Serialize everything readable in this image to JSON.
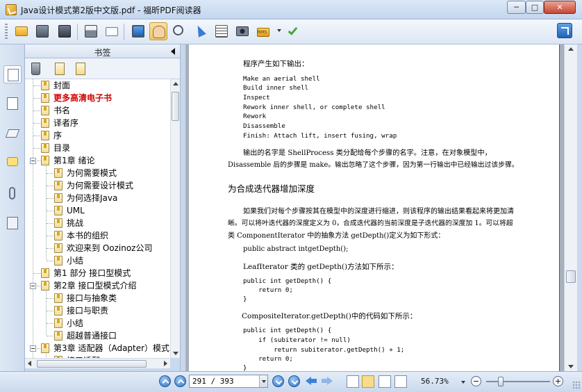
{
  "window": {
    "title": "Java设计模式第2版中文版.pdf - 福昕PDF阅读器",
    "minimize": "─",
    "maximize": "□",
    "close": "✕"
  },
  "toolbar": {
    "icons": [
      "open-folder-icon",
      "save-icon",
      "save-as-icon",
      "print-icon",
      "email-icon",
      "fullscreen-icon",
      "hand-tool-icon",
      "loupe-icon",
      "select-arrow-icon",
      "text-select-icon",
      "snapshot-icon",
      "rms-lock-icon",
      "sign-check-icon"
    ],
    "rms_label": "RMS"
  },
  "sidebar": {
    "title": "书签",
    "tabs": [
      "bookmarks-tab",
      "pages-tab",
      "layers-tab",
      "comments-tab",
      "attachments-tab",
      "signatures-tab"
    ],
    "tools": [
      "delete-bookmark-icon",
      "new-bookmark-icon",
      "new-child-bookmark-icon"
    ],
    "items": [
      {
        "label": "封面",
        "level": 0
      },
      {
        "label": "更多高清电子书",
        "level": 0,
        "highlight": true
      },
      {
        "label": "书名",
        "level": 0
      },
      {
        "label": "译者序",
        "level": 0
      },
      {
        "label": "序",
        "level": 0
      },
      {
        "label": "目录",
        "level": 0
      },
      {
        "label": "第1章 绪论",
        "level": 0,
        "expanded": true
      },
      {
        "label": "为何需要模式",
        "level": 1
      },
      {
        "label": "为何需要设计模式",
        "level": 1
      },
      {
        "label": "为何选择Java",
        "level": 1
      },
      {
        "label": "UML",
        "level": 1
      },
      {
        "label": "挑战",
        "level": 1
      },
      {
        "label": "本书的组织",
        "level": 1
      },
      {
        "label": "欢迎来到 Oozinoz公司",
        "level": 1
      },
      {
        "label": "小结",
        "level": 1
      },
      {
        "label": "第1 部分 接口型模式",
        "level": 0
      },
      {
        "label": "第2章 接口型模式介绍",
        "level": 0,
        "expanded": true
      },
      {
        "label": "接口与抽象类",
        "level": 1
      },
      {
        "label": "接口与职责",
        "level": 1
      },
      {
        "label": "小结",
        "level": 1
      },
      {
        "label": "超越普通接口",
        "level": 1
      },
      {
        "label": "第3章 适配器（Adapter）模式",
        "level": 0,
        "expanded": true
      },
      {
        "label": "接口适配",
        "level": 1
      }
    ]
  },
  "document": {
    "line1": "程序产生如下输出：",
    "output_lines": [
      "Make an aerial shell",
      "Build inner shell",
      "Inspect",
      "Rework inner shell, or complete shell",
      "Rework",
      "Disassemble",
      "Finish: Attach lift, insert fusing, wrap"
    ],
    "para1_line1": "输出的名字是 ShellProcess 类分配给每个步骤的名字。注意，在对象模型中，",
    "para1_line2": "Disassemble 后的步骤是 make。输出忽略了这个步骤，因为第一行输出中已经输出过该步骤。",
    "heading": "为合成迭代器增加深度",
    "para2_line1": "如果我们对每个步骤按其在模型中的深度进行缩进，则该程序的输出结果看起来将更加清",
    "para2_line2": "晰。可以将叶迭代器的深度定义为 0，合成迭代器的当前深度是子迭代器的深度加 1。可以将超",
    "para2_line3": "类 ComponentIterator 中的抽象方法 getDepth()定义为如下形式：",
    "code1": "public abstract intgetDepth();",
    "para3": "LeafIterator 类的 getDepth()方法如下所示：",
    "code2": [
      "public int getDepth() {",
      "    return 0;",
      "}"
    ],
    "para4": "CompositeIterator.getDepth()中的代码如下所示：",
    "code3": [
      "public int getDepth() {",
      "    if (subiterator != null)",
      "        return subiterator.getDepth() + 1;",
      "    return 0;",
      "}"
    ]
  },
  "statusbar": {
    "page_value": "291 / 393",
    "zoom": "56.73%",
    "icons": [
      "first-page-icon",
      "prev-page-icon",
      "next-page-icon",
      "last-page-icon",
      "back-icon",
      "forward-icon",
      "single-page-icon",
      "continuous-icon",
      "facing-icon",
      "continuous-facing-icon",
      "zoom-out-icon",
      "zoom-in-icon"
    ]
  }
}
